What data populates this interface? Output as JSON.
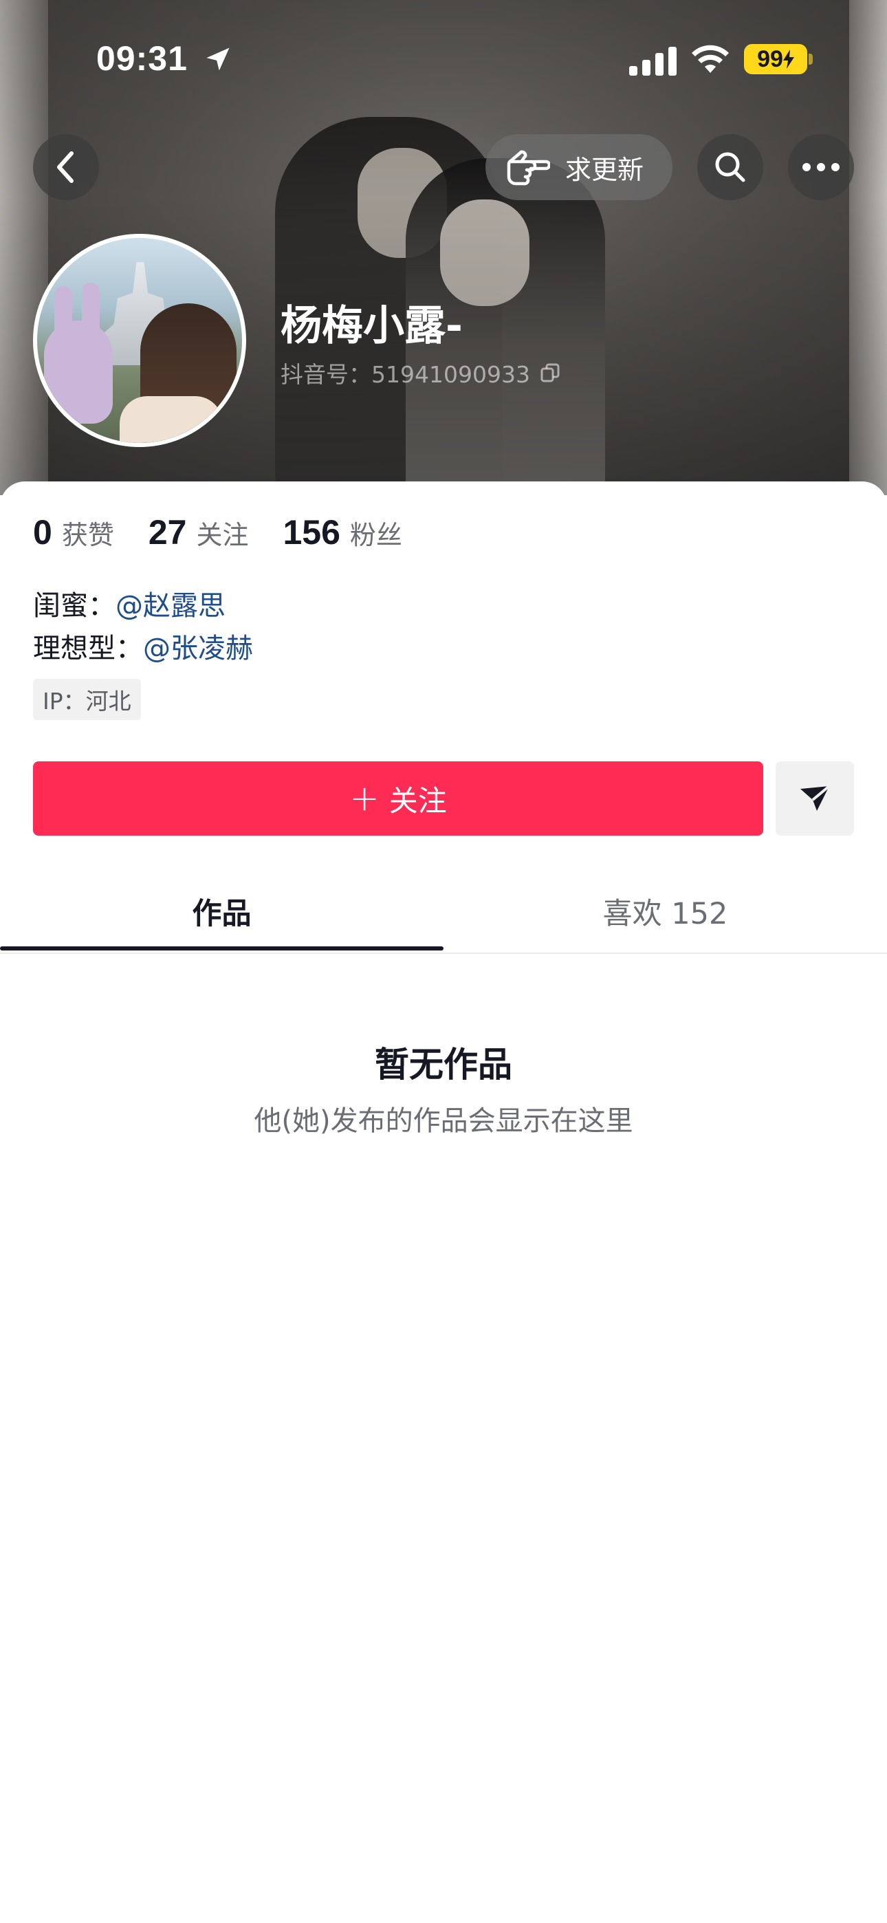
{
  "status_bar": {
    "time": "09:31",
    "battery": "99"
  },
  "header": {
    "request_update_label": "求更新",
    "icons": {
      "back": "chevron-left-icon",
      "request_update": "pointing-hand-icon",
      "search": "search-icon",
      "more": "more-dots-icon"
    }
  },
  "profile": {
    "nickname": "杨梅小露-",
    "douyin_id": "抖音号：51941090933"
  },
  "stats": [
    {
      "value": "0",
      "label": "获赞"
    },
    {
      "value": "27",
      "label": "关注"
    },
    {
      "value": "156",
      "label": "粉丝"
    }
  ],
  "bio": {
    "line1_prefix": "闺蜜：",
    "line1_mention": "@赵露思",
    "line2_prefix": "理想型：",
    "line2_mention": "@张凌赫"
  },
  "ip_tag": "IP：河北",
  "actions": {
    "follow_plus": "+",
    "follow_label": "关注"
  },
  "tabs": [
    {
      "label": "作品"
    },
    {
      "label": "喜欢 152"
    }
  ],
  "empty_state": {
    "title": "暂无作品",
    "description": "他(她)发布的作品会显示在这里"
  },
  "colors": {
    "accent": "#fe2c55",
    "mention": "#1f4d8c",
    "battery": "#ffd81c"
  }
}
